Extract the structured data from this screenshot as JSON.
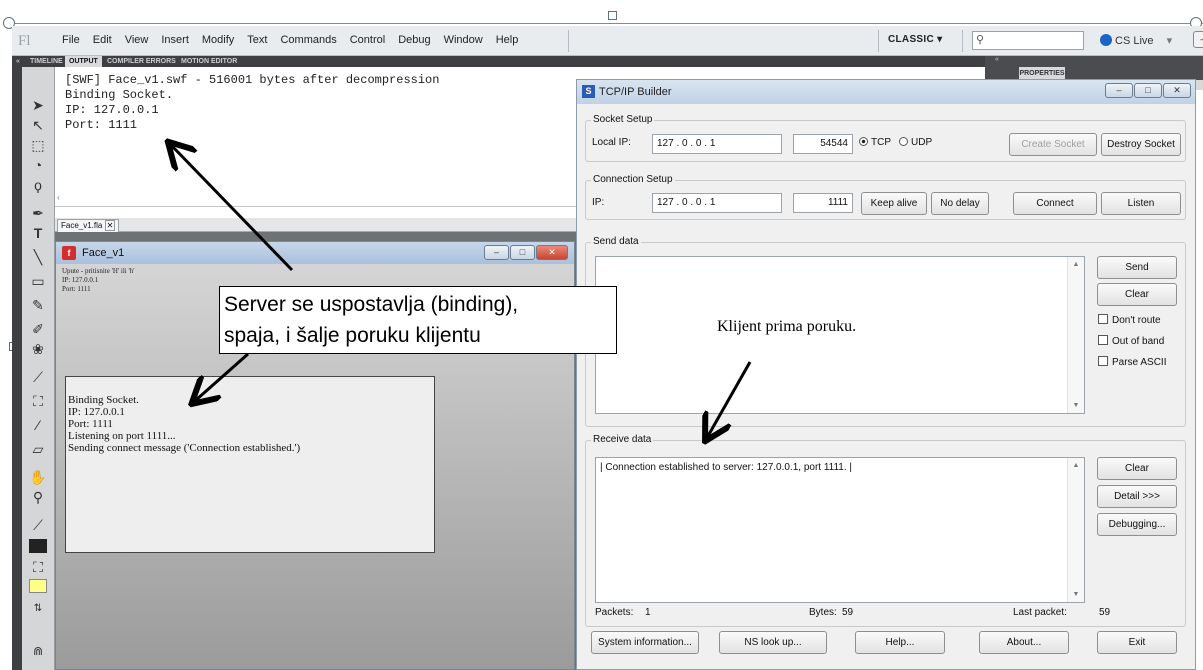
{
  "flash": {
    "logo": "Fl",
    "menu": [
      "File",
      "Edit",
      "View",
      "Insert",
      "Modify",
      "Text",
      "Commands",
      "Control",
      "Debug",
      "Window",
      "Help"
    ],
    "workspace": "CLASSIC ▾",
    "search_placeholder": "",
    "cs_live": "CS Live",
    "panel_tabs": [
      "TIMELINE",
      "OUTPUT",
      "COMPILER ERRORS",
      "MOTION EDITOR"
    ],
    "properties_tab": "PROPERTIES",
    "output_text": "[SWF] Face_v1.swf - 516001 bytes after decompression\nBinding Socket.\nIP: 127.0.0.1\nPort: 1111",
    "doc_tab": "Face_v1.fla"
  },
  "face_window": {
    "title": "Face_v1",
    "info_lines": [
      "Upute - pritisnite 'H' ili 'h'",
      "IP: 127.0.0.1",
      "Port: 1111"
    ],
    "log_lines": [
      "Binding Socket.",
      "IP: 127.0.0.1",
      "Port: 1111",
      "Listening on port 1111...",
      "Sending connect message ('Connection established.')"
    ]
  },
  "annotations": {
    "callout_line1": "Server se uspostavlja (binding),",
    "callout_line2": "spaja, i šalje poruku klijentu",
    "note": "Klijent prima poruku."
  },
  "tcp": {
    "title": "TCP/IP Builder",
    "socket_setup": "Socket Setup",
    "local_ip_label": "Local IP:",
    "local_ip": "127  .   0   .   0   .   1",
    "local_port": "54544",
    "tcp_label": "TCP",
    "udp_label": "UDP",
    "create_socket": "Create Socket",
    "destroy_socket": "Destroy Socket",
    "connection_setup": "Connection Setup",
    "ip_label": "IP:",
    "remote_ip": "127  .   0   .   0   .   1",
    "remote_port": "1111",
    "keep_alive": "Keep alive",
    "no_delay": "No delay",
    "connect": "Connect",
    "listen": "Listen",
    "send_data": "Send data",
    "send": "Send",
    "clear": "Clear",
    "dont_route": "Don't route",
    "out_of_band": "Out of band",
    "parse_ascii": "Parse ASCII",
    "receive_data": "Receive data",
    "received": "| Connection established to server: 127.0.0.1, port 1111. |",
    "clear2": "Clear",
    "detail": "Detail >>>",
    "debugging": "Debugging...",
    "packets_label": "Packets:",
    "packets": "1",
    "bytes_label": "Bytes:",
    "bytes": "59",
    "last_packet_label": "Last packet:",
    "last_packet": "59",
    "system_information": "System information...",
    "ns_lookup": "NS look up...",
    "help": "Help...",
    "about": "About...",
    "exit": "Exit"
  },
  "colors": {
    "accent": "#1a64c4",
    "close": "#c8452f"
  }
}
